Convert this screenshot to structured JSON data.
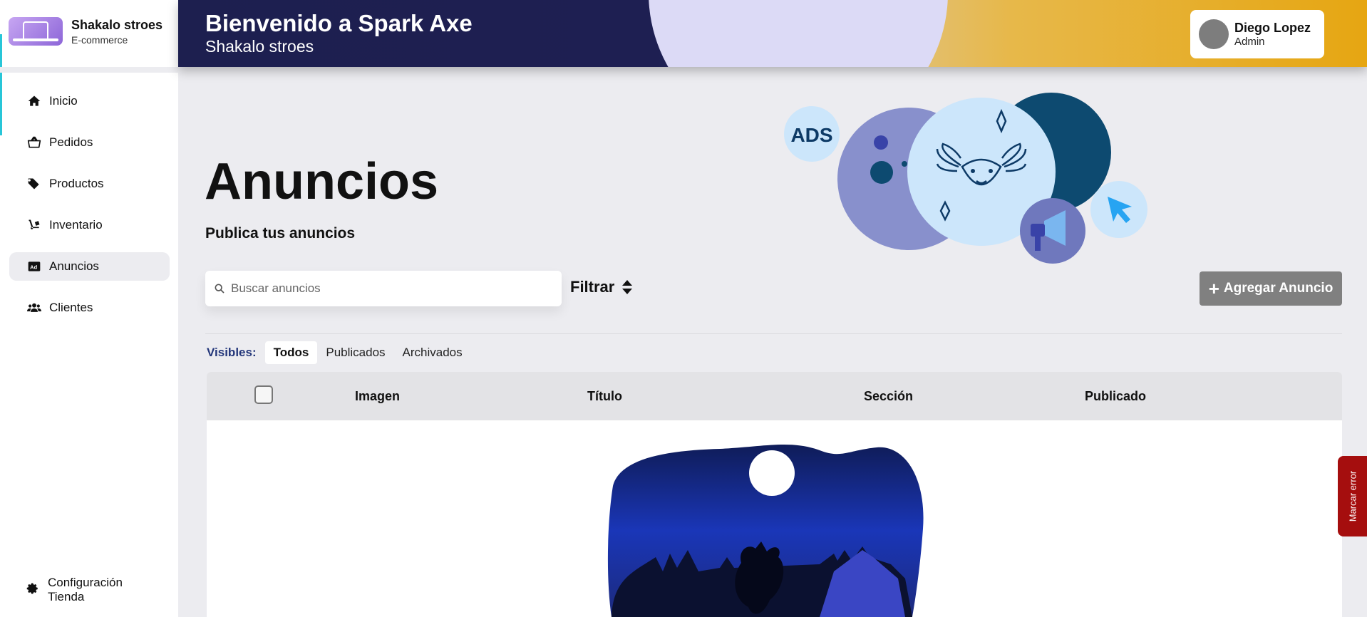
{
  "brand": {
    "name": "Shakalo stroes",
    "subtitle": "E-commerce"
  },
  "sidebar": {
    "items": [
      {
        "label": "Inicio",
        "icon": "home-icon"
      },
      {
        "label": "Pedidos",
        "icon": "basket-icon"
      },
      {
        "label": "Productos",
        "icon": "tags-icon"
      },
      {
        "label": "Inventario",
        "icon": "dolly-icon"
      },
      {
        "label": "Anuncios",
        "icon": "ad-icon",
        "active": true
      },
      {
        "label": "Clientes",
        "icon": "users-icon"
      }
    ],
    "settings_label": "Configuración Tienda"
  },
  "header": {
    "title": "Bienvenido a Spark Axe",
    "subtitle": "Shakalo stroes",
    "user": {
      "name": "Diego Lopez",
      "role": "Admin"
    }
  },
  "main": {
    "title": "Anuncios",
    "subtitle": "Publica tus anuncios",
    "illustration_badge": "ADS",
    "search": {
      "placeholder": "Buscar anuncios",
      "value": ""
    },
    "filter_label": "Filtrar",
    "add_button_label": "Agregar Anuncio",
    "tabs_label": "Visibles:",
    "tabs": [
      "Todos",
      "Publicados",
      "Archivados"
    ],
    "active_tab": "Todos",
    "table": {
      "columns": [
        "Imagen",
        "Título",
        "Sección",
        "Publicado"
      ]
    }
  },
  "report_button_label": "Marcar error",
  "colors": {
    "accent": "#28c6d8",
    "header_dark": "#1d1f4f",
    "header_gold": "#e6a612",
    "add_button": "#808080",
    "tabs_label": "#23367a",
    "report_button": "#a50e0e"
  }
}
